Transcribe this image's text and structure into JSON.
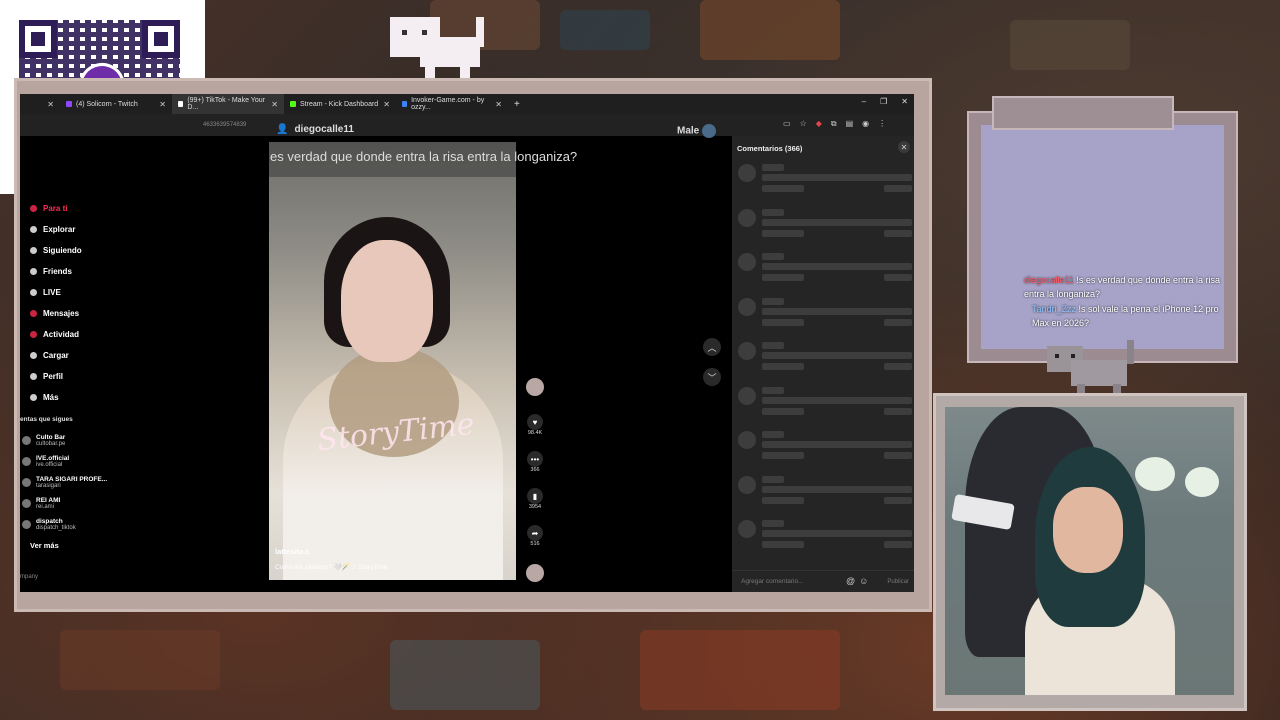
{
  "qr": {
    "brand": "yape"
  },
  "browser": {
    "tabs": [
      {
        "label": "",
        "favicon_color": "#555555",
        "active": false
      },
      {
        "label": "(4) Solicorn - Twitch",
        "favicon_color": "#9146ff",
        "active": false
      },
      {
        "label": "(99+) TikTok - Make Your D...",
        "favicon_color": "#ffffff",
        "active": true
      },
      {
        "label": "Stream - Kick Dashboard",
        "favicon_color": "#53fc18",
        "active": false
      },
      {
        "label": "Invoker-Game.com - by ozzy...",
        "favicon_color": "#3b82f6",
        "active": false
      }
    ],
    "new_tab": "+",
    "window_controls": [
      "–",
      "❐",
      "✕"
    ],
    "url_fragment": "4633639574839",
    "profile_name": "diegocalle11",
    "profile_right": "Male"
  },
  "sidebar": {
    "items": [
      {
        "label": "Para ti",
        "active": true
      },
      {
        "label": "Explorar"
      },
      {
        "label": "Siguiendo"
      },
      {
        "label": "Friends"
      },
      {
        "label": "LIVE"
      },
      {
        "label": "Mensajes"
      },
      {
        "label": "Actividad"
      },
      {
        "label": "Cargar"
      },
      {
        "label": "Perfil"
      },
      {
        "label": "Más"
      }
    ],
    "following_heading": "entas que sigues",
    "accounts": [
      {
        "name": "Culto Bar",
        "handle": "cultobar.pe"
      },
      {
        "name": "IVE.official",
        "handle": "ive.official"
      },
      {
        "name": "TARA SIGARI PROFE...",
        "handle": "tarasigari"
      },
      {
        "name": "REI AMI",
        "handle": "rei.ami"
      },
      {
        "name": "dispatch",
        "handle": "dispatch_tiktok"
      }
    ],
    "see_more": "Ver más",
    "footer": "mpany"
  },
  "video": {
    "caption": "es verdad que donde entra la risa entra la longaniza?",
    "overlay_text": "StoryTime",
    "author": "lattesita.c",
    "description": "Como me pidieron? 🤍🪄 ♫ StoryTime",
    "likes": "98.4K",
    "comments": "366",
    "saves": "3954",
    "shares": "516"
  },
  "comments_panel": {
    "title": "Comentarios (366)",
    "placeholder": "Agregar comentario...",
    "publish": "Publicar"
  },
  "chat": {
    "messages": [
      {
        "user": "diegocalle11",
        "text": "!s es verdad que donde entra la risa entra la longaniza?",
        "user_color": "#ff5a64"
      },
      {
        "user": "Tandri_Zzz",
        "text": "!s sol vale la pena el iPhone 12 pro Max en 2026?",
        "user_color": "#8ec6ff"
      }
    ]
  },
  "colors": {
    "accent": "#fe2c55",
    "panel": "#252525",
    "skeleton": "#3d3d3d"
  }
}
